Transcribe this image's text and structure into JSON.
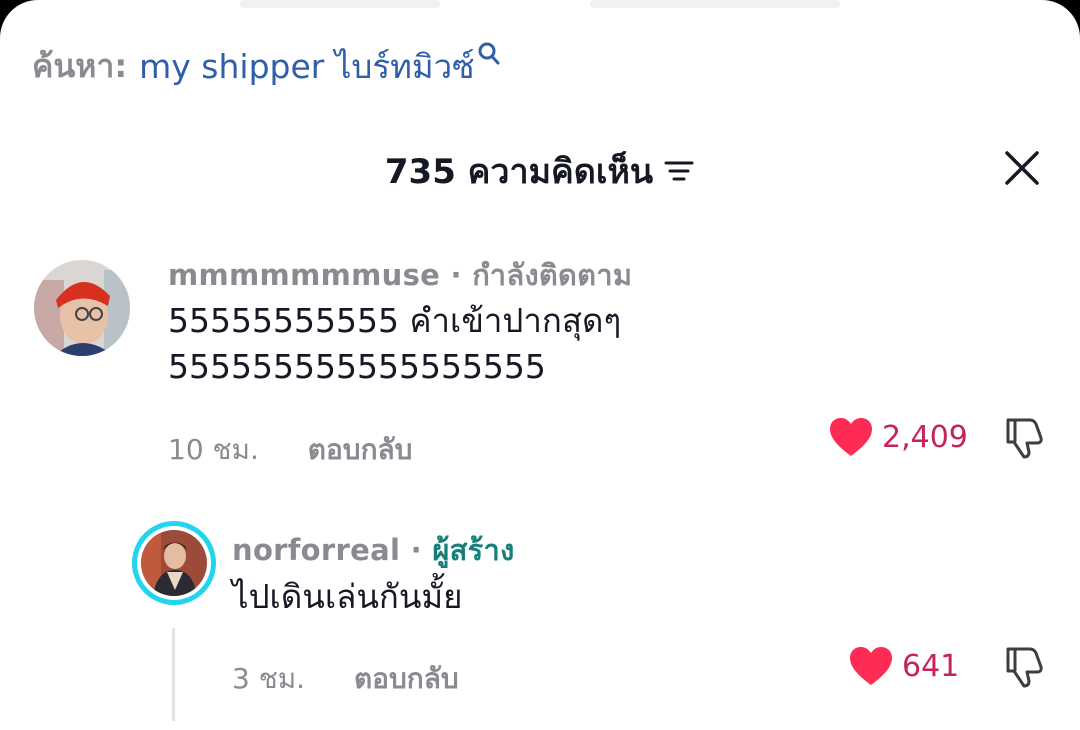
{
  "search": {
    "prefix": "ค้นหา:",
    "term": "my shipper ไบร์ทมิวซ์"
  },
  "header": {
    "title": "735 ความคิดเห็น"
  },
  "comments": [
    {
      "username": "mmmmmmmuse",
      "relation": "· กำลังติดตาม",
      "line1": "55555555555 คำเข้าปากสุดๆ",
      "line2": "555555555555555555",
      "time": "10 ชม.",
      "reply_label": "ตอบกลับ",
      "likes": "2,409"
    }
  ],
  "replies": [
    {
      "username": "norforreal",
      "separator": " · ",
      "creator_label": "ผู้สร้าง",
      "text": "ไปเดินเล่นกันมั้ย",
      "time": "3 ชม.",
      "reply_label": "ตอบกลับ",
      "likes": "641"
    }
  ],
  "colors": {
    "accent_like": "#fe2c55",
    "creator": "#15807a",
    "search_term": "#2f5fa8",
    "story_ring": "#20d5ec"
  }
}
